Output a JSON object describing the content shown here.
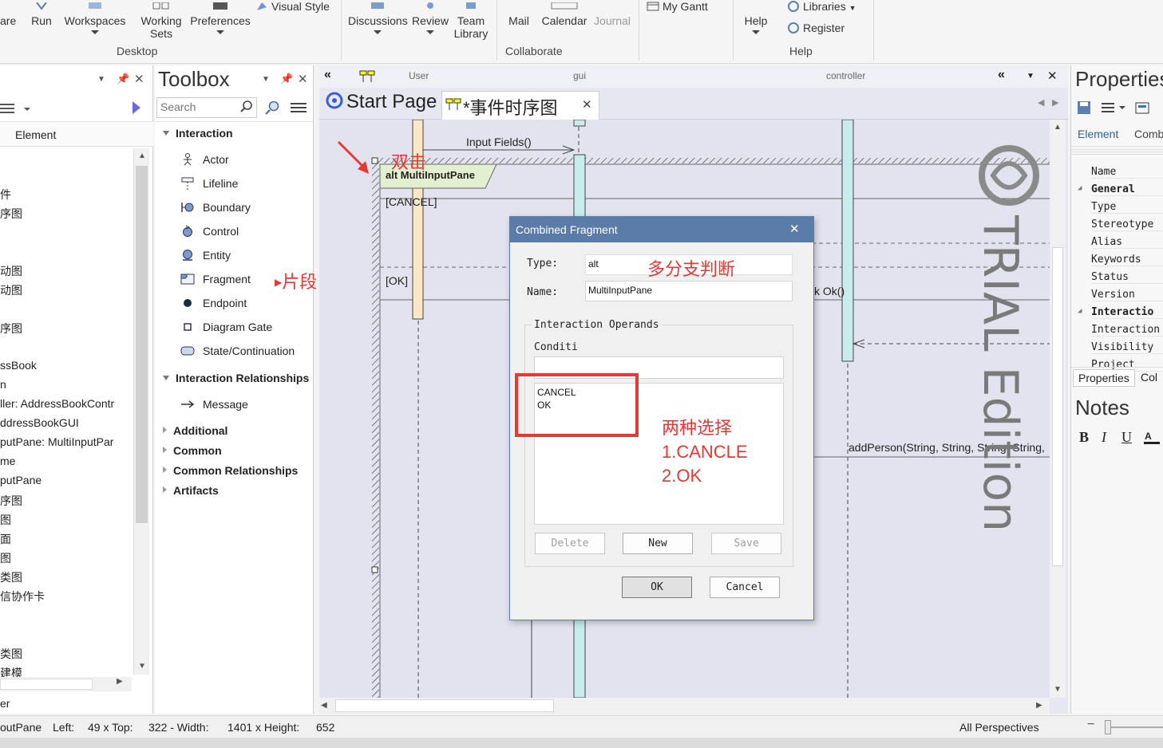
{
  "ribbon": {
    "buttons": {
      "share_partial": "are",
      "run": "Run",
      "workspaces": "Workspaces",
      "working_sets_line1": "Working",
      "working_sets_line2": "Sets",
      "preferences": "Preferences",
      "visual_style": "Visual Style",
      "discussions": "Discussions",
      "review": "Review",
      "team_library_line1": "Team",
      "team_library_line2": "Library",
      "mail": "Mail",
      "calendar": "Calendar",
      "journal": "Journal",
      "my_gantt": "My Gantt",
      "help": "Help",
      "libraries": "Libraries",
      "register": "Register"
    },
    "groups": {
      "desktop": "Desktop",
      "collaborate": "Collaborate",
      "help": "Help"
    }
  },
  "browser": {
    "tab_element": "Element",
    "items": [
      "件",
      "序图",
      "动图",
      "动图",
      "序图",
      "ssBook",
      "n",
      "ller: AddressBookContr",
      "ddressBookGUI",
      "putPane: MultiInputPar",
      "me",
      "putPane",
      "序图",
      "图",
      "面",
      "图",
      "类图",
      "信协作卡",
      "类图",
      "建模"
    ],
    "footer": "er"
  },
  "toolbox": {
    "title": "Toolbox",
    "search_placeholder": "Search",
    "sections": {
      "interaction": "Interaction",
      "interaction_relationships": "Interaction Relationships",
      "additional": "Additional",
      "common": "Common",
      "common_relationships": "Common Relationships",
      "artifacts": "Artifacts"
    },
    "interaction_items": [
      "Actor",
      "Lifeline",
      "Boundary",
      "Control",
      "Entity",
      "Fragment",
      "Endpoint",
      "Diagram Gate",
      "State/Continuation"
    ],
    "relationship_items": [
      "Message"
    ]
  },
  "diagram": {
    "header_lifelines": {
      "user": "User",
      "gui": "gui",
      "controller": "controller"
    },
    "tabs": {
      "start_page": "Start Page",
      "sequence": "*事件时序图"
    },
    "messages": {
      "input_fields": "Input Fields()",
      "ok_partial": "k Ok()",
      "add_person": "addPerson(String, String, String, String,"
    },
    "fragment": {
      "label": "alt MultiInputPane",
      "guard_cancel": "[CANCEL]",
      "guard_ok": "[OK]"
    },
    "watermark": "TRIAL Edition"
  },
  "annotations": {
    "double_click": "双击",
    "fragment": "片段",
    "multi_branch": "多分支判断",
    "two_choices_line1": "两种选择",
    "two_choices_line2": "1.CANCLE",
    "two_choices_line3": "2.OK"
  },
  "dialog": {
    "title": "Combined Fragment",
    "type_label": "Type:",
    "type_value": "alt",
    "name_label": "Name:",
    "name_value": "MultiInputPane",
    "operands_legend": "Interaction Operands",
    "condition_label": "Conditi",
    "condition_value": "",
    "operands": [
      "CANCEL",
      "OK"
    ],
    "delete_button": "Delete",
    "new_button": "New",
    "save_button": "Save",
    "ok_button": "OK",
    "cancel_button": "Cancel"
  },
  "properties": {
    "title": "Properties",
    "tabs": {
      "element": "Element",
      "comb": "Comb"
    },
    "rows": [
      "Name",
      "General",
      "Type",
      "Stereotype",
      "Alias",
      "Keywords",
      "Status",
      "Version",
      "Interactio",
      "Interaction",
      "Visibility",
      "Project"
    ],
    "bottom_tabs": {
      "properties": "Properties",
      "col": "Col"
    },
    "notes_title": "Notes",
    "format": {
      "bold": "B",
      "italic": "I",
      "underline": "U"
    }
  },
  "status": {
    "element": "outPane",
    "left_label": "Left:",
    "left_value": "49 x Top:",
    "top_value": "322 - Width:",
    "width_value": "1401 x Height:",
    "height_value": "652",
    "perspectives": "All Perspectives"
  },
  "colors": {
    "dialog_title": "#5b7ba8",
    "annotation_red": "#e53935",
    "lifeline_activation": "#c8ecec",
    "user_activation": "#fbe7c6",
    "fragment_label": "#e2f0d0"
  }
}
